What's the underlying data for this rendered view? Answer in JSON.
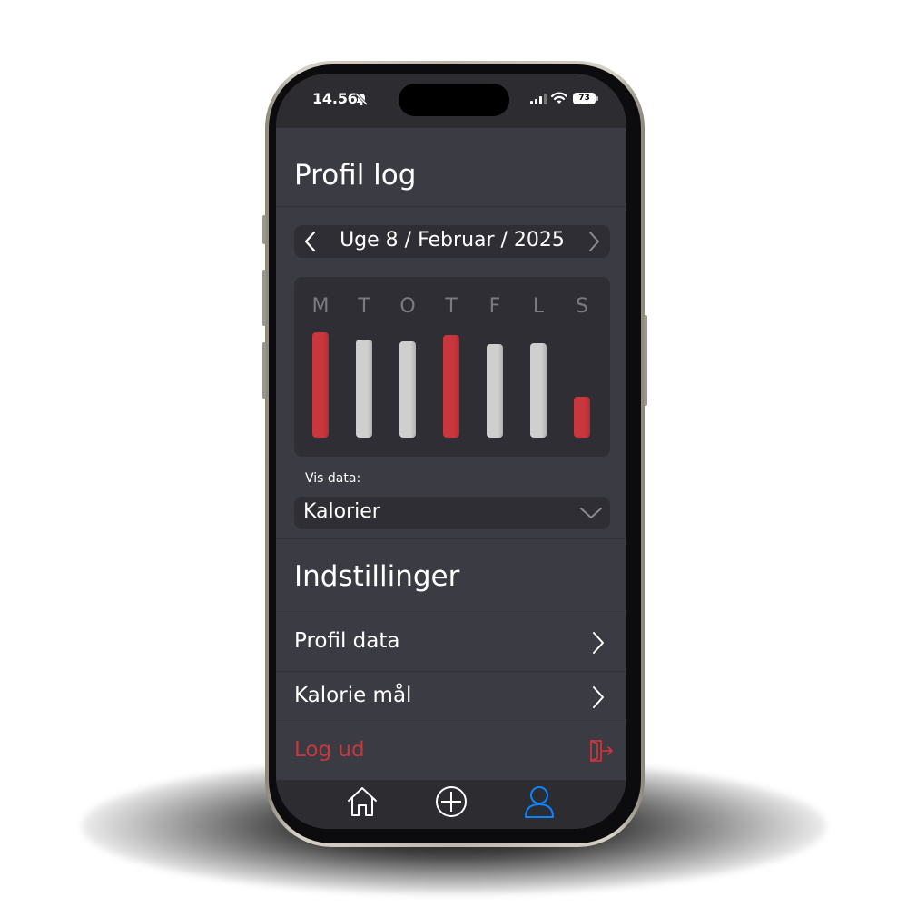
{
  "status": {
    "time": "14.56",
    "battery": "73"
  },
  "header": {
    "title": "Profil log"
  },
  "week": {
    "label": "Uge 8 / Februar / 2025"
  },
  "chart_data": {
    "type": "bar",
    "categories": [
      "M",
      "T",
      "O",
      "T",
      "F",
      "L",
      "S"
    ],
    "values": [
      1.0,
      0.93,
      0.91,
      0.97,
      0.89,
      0.9,
      0.39
    ],
    "status": [
      "over",
      "under",
      "under",
      "over",
      "under",
      "under",
      "over"
    ],
    "colors": {
      "over": "#c9363c",
      "under": "#cfcfcf"
    },
    "ylim": [
      0,
      1
    ]
  },
  "filter": {
    "label": "Vis data:",
    "value": "Kalorier"
  },
  "settings": {
    "title": "Indstillinger",
    "items": [
      {
        "label": "Profil data"
      },
      {
        "label": "Kalorie mål"
      }
    ],
    "logout": "Log ud"
  },
  "accent": {
    "active": "#0a84ff",
    "danger": "#c9363c"
  },
  "tabs": [
    {
      "icon": "home-icon",
      "active": false
    },
    {
      "icon": "add-circle-icon",
      "active": false
    },
    {
      "icon": "profile-icon",
      "active": true
    }
  ]
}
